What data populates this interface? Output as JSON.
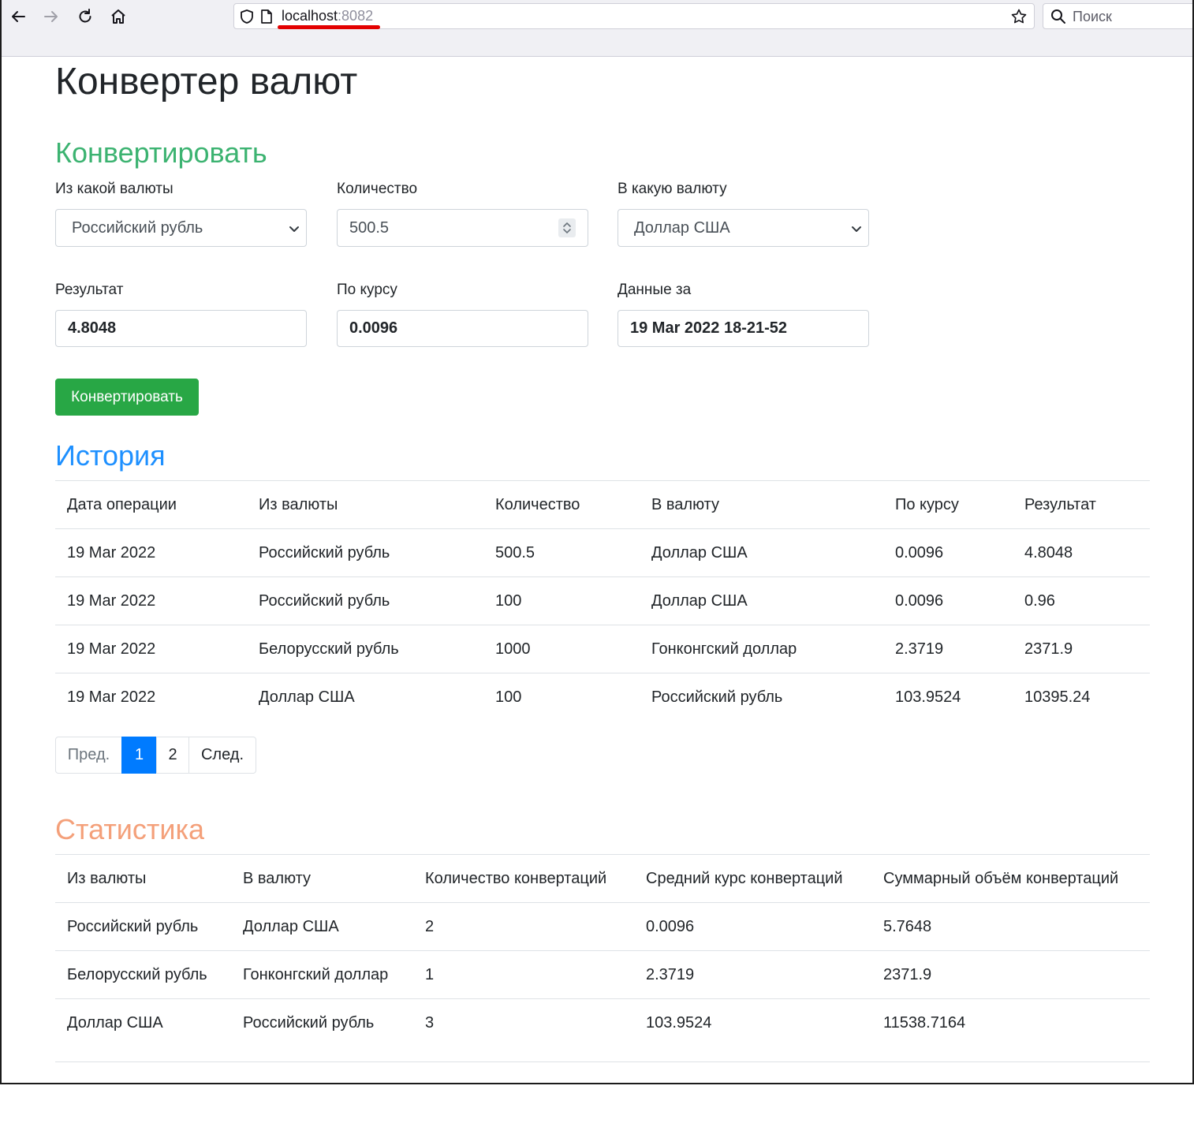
{
  "browser": {
    "url_host": "localhost",
    "url_port": ":8082",
    "search_placeholder": "Поиск"
  },
  "page": {
    "title": "Конвертер валют"
  },
  "convert": {
    "heading": "Конвертировать",
    "from_label": "Из какой валюты",
    "from_value": "Российский рубль",
    "amount_label": "Количество",
    "amount_value": "500.5",
    "to_label": "В какую валюту",
    "to_value": "Доллар США",
    "result_label": "Результат",
    "result_value": "4.8048",
    "rate_label": "По курсу",
    "rate_value": "0.0096",
    "date_label": "Данные за",
    "date_value": "19 Mar 2022 18-21-52",
    "button_label": "Конвертировать"
  },
  "history": {
    "heading": "История",
    "columns": [
      "Дата операции",
      "Из валюты",
      "Количество",
      "В валюту",
      "По курсу",
      "Результат"
    ],
    "rows": [
      [
        "19 Mar 2022",
        "Российский рубль",
        "500.5",
        "Доллар США",
        "0.0096",
        "4.8048"
      ],
      [
        "19 Mar 2022",
        "Российский рубль",
        "100",
        "Доллар США",
        "0.0096",
        "0.96"
      ],
      [
        "19 Mar 2022",
        "Белорусский рубль",
        "1000",
        "Гонконгский доллар",
        "2.3719",
        "2371.9"
      ],
      [
        "19 Mar 2022",
        "Доллар США",
        "100",
        "Российский рубль",
        "103.9524",
        "10395.24"
      ]
    ],
    "pagination": {
      "prev": "Пред.",
      "pages": [
        "1",
        "2"
      ],
      "active_page": "1",
      "next": "След."
    }
  },
  "stats": {
    "heading": "Статистика",
    "columns": [
      "Из валюты",
      "В валюту",
      "Количество конвертаций",
      "Средний курс конвертаций",
      "Суммарный объём конвертаций"
    ],
    "rows": [
      [
        "Российский рубль",
        "Доллар США",
        "2",
        "0.0096",
        "5.7648"
      ],
      [
        "Белорусский рубль",
        "Гонконгский доллар",
        "1",
        "2.3719",
        "2371.9"
      ],
      [
        "Доллар США",
        "Российский рубль",
        "3",
        "103.9524",
        "11538.7164"
      ]
    ]
  },
  "colors": {
    "convert_heading": "#3cb371",
    "history_heading": "#1e90ff",
    "stats_heading": "#f4a07a",
    "button_green": "#28a745",
    "page_active": "#007bff",
    "url_underline": "#e30000"
  }
}
